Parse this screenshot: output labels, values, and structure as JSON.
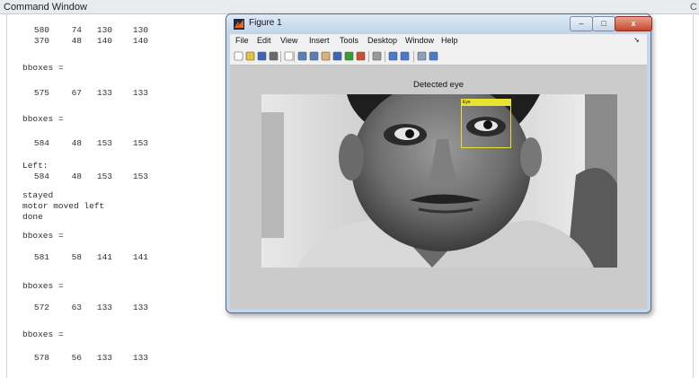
{
  "command_window": {
    "title": "Command Window",
    "right_edge_char": "C",
    "lines": [
      {
        "kind": "row",
        "values": [
          "580",
          "74",
          "130",
          "130"
        ]
      },
      {
        "kind": "row",
        "values": [
          "370",
          "48",
          "140",
          "140"
        ]
      },
      {
        "kind": "text",
        "text": "bboxes ="
      },
      {
        "kind": "row",
        "values": [
          "575",
          "67",
          "133",
          "133"
        ]
      },
      {
        "kind": "text",
        "text": "bboxes ="
      },
      {
        "kind": "row",
        "values": [
          "584",
          "48",
          "153",
          "153"
        ]
      },
      {
        "kind": "text",
        "text": "Left:"
      },
      {
        "kind": "row",
        "values": [
          "584",
          "48",
          "153",
          "153"
        ]
      },
      {
        "kind": "text",
        "text": "stayed"
      },
      {
        "kind": "text",
        "text": "motor moved left"
      },
      {
        "kind": "text",
        "text": "done"
      },
      {
        "kind": "text",
        "text": "bboxes ="
      },
      {
        "kind": "row",
        "values": [
          "581",
          "58",
          "141",
          "141"
        ]
      },
      {
        "kind": "text",
        "text": "bboxes ="
      },
      {
        "kind": "row",
        "values": [
          "572",
          "63",
          "133",
          "133"
        ]
      },
      {
        "kind": "text",
        "text": "bboxes ="
      },
      {
        "kind": "row",
        "values": [
          "578",
          "56",
          "133",
          "133"
        ]
      }
    ]
  },
  "figure": {
    "title": "Figure 1",
    "menu": [
      "File",
      "Edit",
      "View",
      "Insert",
      "Tools",
      "Desktop",
      "Window",
      "Help"
    ],
    "menu_arrow": "➘",
    "axes_title": "Detected eye",
    "bbox_label": "Eye",
    "close_glyph": "x",
    "min_glyph": "–",
    "max_glyph": "□",
    "toolbar_icons": [
      "new-figure-icon",
      "open-icon",
      "save-icon",
      "print-icon",
      "pointer-icon",
      "zoom-in-icon",
      "zoom-out-icon",
      "pan-icon",
      "rotate-icon",
      "data-cursor-icon",
      "brush-icon",
      "link-icon",
      "colorbar-icon",
      "legend-icon",
      "hide-plot-tools-icon",
      "show-plot-tools-icon"
    ]
  },
  "colors": {
    "bbox": "#e8e231",
    "fig_frame": "#c3d6ea",
    "canvas": "#cbcbcb"
  }
}
